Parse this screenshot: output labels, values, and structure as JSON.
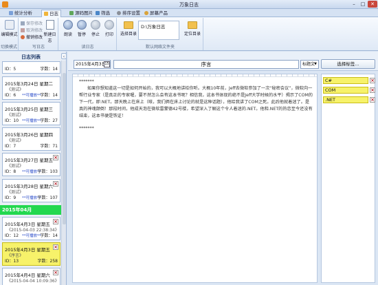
{
  "window": {
    "title": "万象日志",
    "min": "–",
    "max": "□",
    "close": "✕"
  },
  "tabs": [
    {
      "label": "统计分析"
    },
    {
      "label": "日志"
    },
    {
      "label": "源码图片"
    },
    {
      "label": "筛选"
    },
    {
      "label": "排序设置"
    },
    {
      "label": "屏幕产品"
    }
  ],
  "ribbon": {
    "view": {
      "edit_mode": "编辑模式",
      "label": "切换模式"
    },
    "log": {
      "save": "保存修改",
      "cancel": "取消修改",
      "undo": "撤销修改",
      "new_log": "新建日志",
      "label": "写日志"
    },
    "reader": {
      "read": "朗读",
      "pause": "暂停",
      "stop": "停止",
      "print": "打印",
      "label": "读日志"
    },
    "directory": {
      "select": "选择目录",
      "path": "D:\\万象日志",
      "locate": "定位目录",
      "label": "默认网络文件夹"
    }
  },
  "left_panel": {
    "title": "日志列表",
    "collapse": "‹",
    "month_label": "2015年04月",
    "entries": [
      {
        "date": "",
        "sub": "",
        "id": "ID：5",
        "flag": "",
        "count": "字数：14"
      },
      {
        "date": "2015年3月24日 星期二",
        "sub": "《测试》",
        "id": "ID：6",
        "flag": "**可播放**",
        "count": "字数：14"
      },
      {
        "date": "2015年3月25日 星期三",
        "sub": "《测试》",
        "id": "ID：10",
        "flag": "**可播放**",
        "count": "字数：27"
      },
      {
        "date": "2015年3月26日 星期四",
        "sub": "《测试》",
        "id": "ID：7",
        "flag": "",
        "count": "字数：71"
      },
      {
        "date": "2015年3月27日 星期五",
        "sub": "《测试》",
        "id": "ID：8",
        "flag": "**可播放**",
        "count": "字数：103"
      },
      {
        "date": "2015年3月28日 星期六",
        "sub": "《测试》",
        "id": "ID：9",
        "flag": "**可播放**",
        "count": "字数：107"
      },
      {
        "date": "2015年4月3日 星期五",
        "sub": "《2015-04-03 22:38:34》",
        "id": "ID：12",
        "flag": "**可播放**",
        "count": "字数：14"
      },
      {
        "date": "2015年4月3日 星期五",
        "sub": "《序言》",
        "id": "ID：13",
        "flag": "",
        "count": "字数：258"
      },
      {
        "date": "2015年4月4日 星期六",
        "sub": "《2015-04-04 10:09:36》",
        "id": "",
        "flag": "",
        "count": ""
      }
    ]
  },
  "editor": {
    "date": "2015年4月3日",
    "calendar_icon": "15",
    "title": "序言",
    "style": "标题文",
    "tag_button": "选择标签...",
    "stars_top": "*******",
    "body": "如果你想知道这一切是如何开始的，我可以大概地讲给你听。大概10年前，Jeff去微软参加了一次“秘密会议”，微软向一帮行业专家（是真正的专家喔，要不然怎么会有这本书呢？相信我，这本书体现的绝不是Jeff大学时候的水平）揭示了COM的下一代，即.NET。那天晚上在床上（咳，我们俩在床上讨论的就是这种话题），他给我讲了COM之死。此后他就着迷了。是真的神魂颠倒！那段时间，他成天泡在微软雷蒙德42号楼，希望深入了解这个令人着迷的.NET。他和.NET的热恋至今还没有结束，这本书便是铁证！",
    "stars_bottom": "*******"
  },
  "tags": [
    {
      "label": "C#"
    },
    {
      "label": "COM"
    },
    {
      "label": ".NET"
    }
  ],
  "colors": {
    "selected": "#f7f26a",
    "month_bar": "#23d84f",
    "flag_text": "#2447c8",
    "delete_x": "#b3232c"
  }
}
